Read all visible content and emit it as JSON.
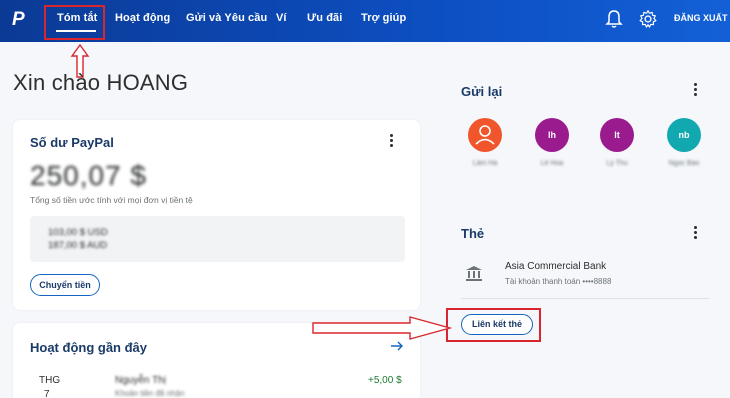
{
  "nav": {
    "logo": "P",
    "items": [
      "Tóm tắt",
      "Hoạt động",
      "Gửi và Yêu cầu",
      "Ví",
      "Ưu đãi",
      "Trợ giúp"
    ],
    "logout": "ĐĂNG XUẤT"
  },
  "greeting": "Xin chào HOANG",
  "balance_card": {
    "title": "Số dư PayPal",
    "amount": "250,07 $",
    "subtitle": "Tổng số tiền ước tính với mọi đơn vị tiền tệ",
    "currencies": [
      "103,00 $ USD",
      "187,00 $ AUD"
    ],
    "transfer_label": "Chuyển tiền"
  },
  "activity": {
    "title": "Hoạt động gần đây",
    "item": {
      "month": "THG",
      "day": "7",
      "name": "Nguyễn Thị",
      "sub": "Khoản tiền đã nhận",
      "amount": "+5,00 $"
    }
  },
  "send_again": {
    "title": "Gửi lại",
    "contacts": [
      {
        "initials": "",
        "name": "Lâm Hà",
        "color": "#f0552b"
      },
      {
        "initials": "lh",
        "name": "Lê Hoa",
        "color": "#9a1b8e"
      },
      {
        "initials": "lt",
        "name": "Lý Thu",
        "color": "#9a1b8e"
      },
      {
        "initials": "nb",
        "name": "Ngọc Bảo",
        "color": "#12a8b0"
      }
    ]
  },
  "cards": {
    "title": "Thẻ",
    "bank_name": "Asia Commercial Bank",
    "bank_sub": "Tài khoản thanh toán ••••8888",
    "link_label": "Liên kết thẻ"
  },
  "colors": {
    "nav": "#0d4fc2",
    "accent": "#1565c0",
    "highlight": "#d9262e"
  }
}
